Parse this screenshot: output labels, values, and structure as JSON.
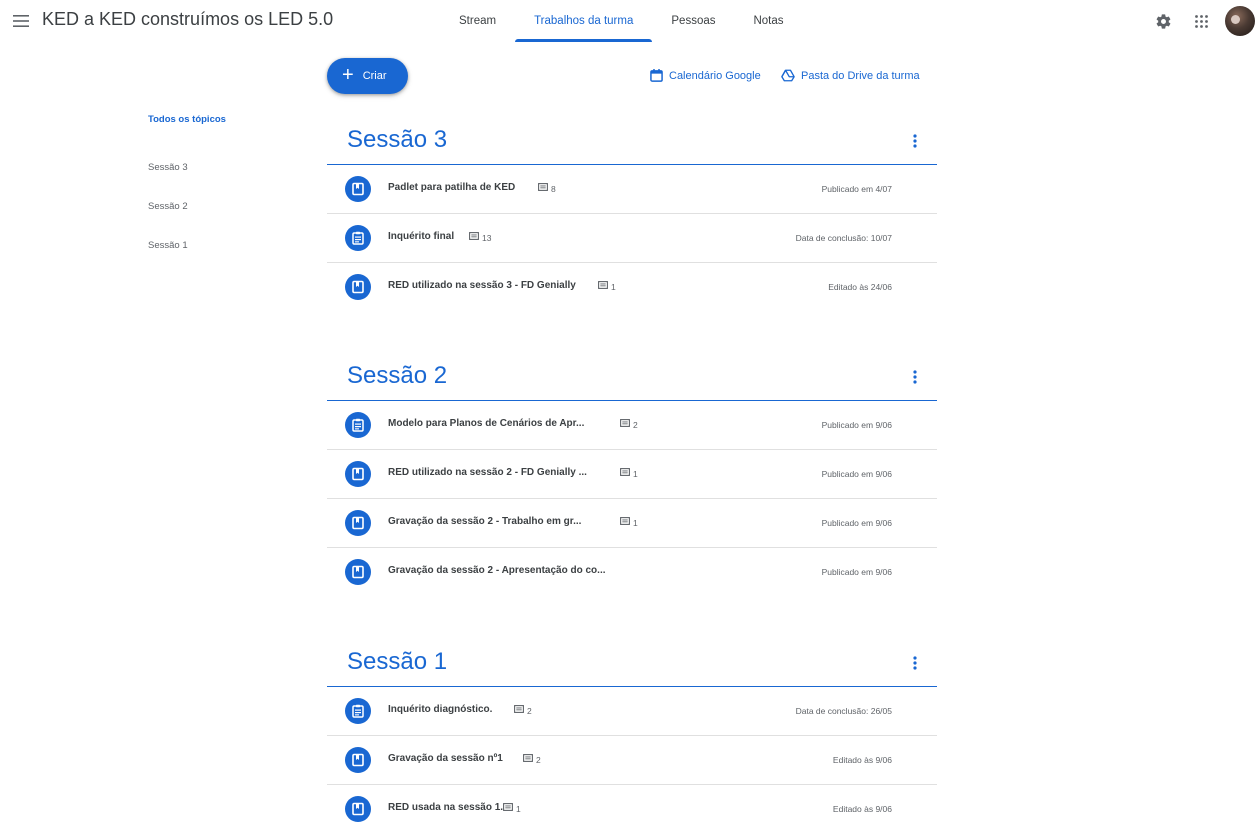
{
  "app": {
    "title": "KED a KED construímos os LED 5.0"
  },
  "tabs": [
    {
      "label": "Stream"
    },
    {
      "label": "Trabalhos da turma"
    },
    {
      "label": "Pessoas"
    },
    {
      "label": "Notas"
    }
  ],
  "actions": {
    "create_label": "Criar",
    "calendar_label": "Calendário Google",
    "drive_label": "Pasta do Drive da turma"
  },
  "topics": [
    {
      "label": "Todos os tópicos"
    },
    {
      "label": "Sessão 3"
    },
    {
      "label": "Sessão 2"
    },
    {
      "label": "Sessão 1"
    }
  ],
  "sections": [
    {
      "title": "Sessão 3",
      "items": [
        {
          "icon": "material-icon",
          "title": "Padlet para patilha de KED",
          "comments": "8",
          "status": "Publicado em 4/07"
        },
        {
          "icon": "assignment-icon",
          "title": "Inquérito final",
          "comments": "13",
          "status": "Data de conclusão: 10/07"
        },
        {
          "icon": "material-icon",
          "title": "RED utilizado na sessão 3 - FD Genially",
          "comments": "1",
          "status": "Editado às 24/06"
        }
      ]
    },
    {
      "title": "Sessão 2",
      "items": [
        {
          "icon": "assignment-icon",
          "title": "Modelo para Planos de Cenários de Apr...",
          "comments": "2",
          "status": "Publicado em 9/06"
        },
        {
          "icon": "material-icon",
          "title": "RED utilizado na sessão 2 - FD Genially ...",
          "comments": "1",
          "status": "Publicado em 9/06"
        },
        {
          "icon": "material-icon",
          "title": "Gravação da sessão 2 - Trabalho em gr...",
          "comments": "1",
          "status": "Publicado em 9/06"
        },
        {
          "icon": "material-icon",
          "title": "Gravação da sessão 2 - Apresentação do co...",
          "comments": "",
          "status": "Publicado em 9/06"
        }
      ]
    },
    {
      "title": "Sessão 1",
      "items": [
        {
          "icon": "assignment-icon",
          "title": "Inquérito diagnóstico.",
          "comments": "2",
          "status": "Data de conclusão: 26/05"
        },
        {
          "icon": "material-icon",
          "title": "Gravação da sessão nº1",
          "comments": "2",
          "status": "Editado às 9/06"
        },
        {
          "icon": "material-icon",
          "title": "RED usada na sessão 1.",
          "comments": "1",
          "status": "Editado às 9/06"
        }
      ]
    }
  ],
  "colors": {
    "accent": "#1967d2",
    "divider": "#e0e0e0",
    "text": "#3c4043",
    "muted": "#5f6368"
  }
}
